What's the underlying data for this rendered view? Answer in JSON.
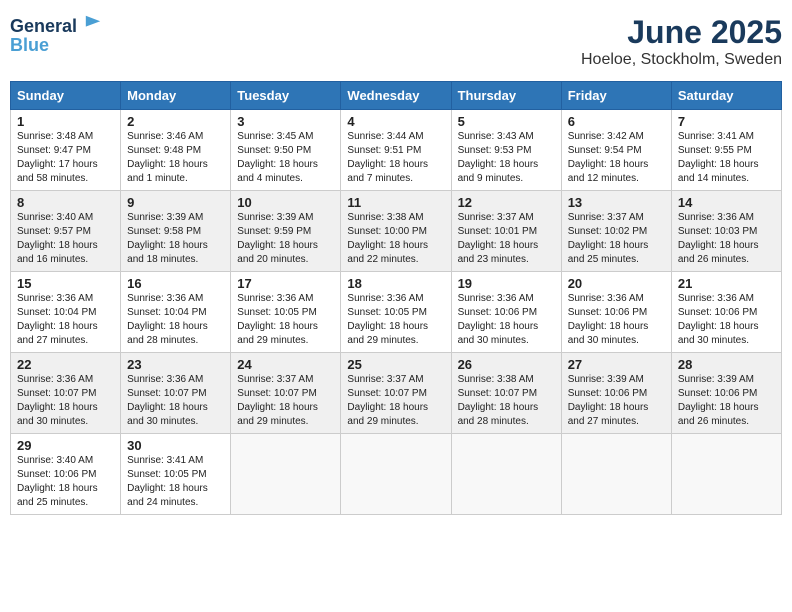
{
  "header": {
    "logo_line1": "General",
    "logo_line2": "Blue",
    "month_year": "June 2025",
    "location": "Hoeloe, Stockholm, Sweden"
  },
  "days_of_week": [
    "Sunday",
    "Monday",
    "Tuesday",
    "Wednesday",
    "Thursday",
    "Friday",
    "Saturday"
  ],
  "weeks": [
    [
      {
        "day": 1,
        "sunrise": "3:48 AM",
        "sunset": "9:47 PM",
        "daylight": "17 hours and 58 minutes."
      },
      {
        "day": 2,
        "sunrise": "3:46 AM",
        "sunset": "9:48 PM",
        "daylight": "18 hours and 1 minute."
      },
      {
        "day": 3,
        "sunrise": "3:45 AM",
        "sunset": "9:50 PM",
        "daylight": "18 hours and 4 minutes."
      },
      {
        "day": 4,
        "sunrise": "3:44 AM",
        "sunset": "9:51 PM",
        "daylight": "18 hours and 7 minutes."
      },
      {
        "day": 5,
        "sunrise": "3:43 AM",
        "sunset": "9:53 PM",
        "daylight": "18 hours and 9 minutes."
      },
      {
        "day": 6,
        "sunrise": "3:42 AM",
        "sunset": "9:54 PM",
        "daylight": "18 hours and 12 minutes."
      },
      {
        "day": 7,
        "sunrise": "3:41 AM",
        "sunset": "9:55 PM",
        "daylight": "18 hours and 14 minutes."
      }
    ],
    [
      {
        "day": 8,
        "sunrise": "3:40 AM",
        "sunset": "9:57 PM",
        "daylight": "18 hours and 16 minutes."
      },
      {
        "day": 9,
        "sunrise": "3:39 AM",
        "sunset": "9:58 PM",
        "daylight": "18 hours and 18 minutes."
      },
      {
        "day": 10,
        "sunrise": "3:39 AM",
        "sunset": "9:59 PM",
        "daylight": "18 hours and 20 minutes."
      },
      {
        "day": 11,
        "sunrise": "3:38 AM",
        "sunset": "10:00 PM",
        "daylight": "18 hours and 22 minutes."
      },
      {
        "day": 12,
        "sunrise": "3:37 AM",
        "sunset": "10:01 PM",
        "daylight": "18 hours and 23 minutes."
      },
      {
        "day": 13,
        "sunrise": "3:37 AM",
        "sunset": "10:02 PM",
        "daylight": "18 hours and 25 minutes."
      },
      {
        "day": 14,
        "sunrise": "3:36 AM",
        "sunset": "10:03 PM",
        "daylight": "18 hours and 26 minutes."
      }
    ],
    [
      {
        "day": 15,
        "sunrise": "3:36 AM",
        "sunset": "10:04 PM",
        "daylight": "18 hours and 27 minutes."
      },
      {
        "day": 16,
        "sunrise": "3:36 AM",
        "sunset": "10:04 PM",
        "daylight": "18 hours and 28 minutes."
      },
      {
        "day": 17,
        "sunrise": "3:36 AM",
        "sunset": "10:05 PM",
        "daylight": "18 hours and 29 minutes."
      },
      {
        "day": 18,
        "sunrise": "3:36 AM",
        "sunset": "10:05 PM",
        "daylight": "18 hours and 29 minutes."
      },
      {
        "day": 19,
        "sunrise": "3:36 AM",
        "sunset": "10:06 PM",
        "daylight": "18 hours and 30 minutes."
      },
      {
        "day": 20,
        "sunrise": "3:36 AM",
        "sunset": "10:06 PM",
        "daylight": "18 hours and 30 minutes."
      },
      {
        "day": 21,
        "sunrise": "3:36 AM",
        "sunset": "10:06 PM",
        "daylight": "18 hours and 30 minutes."
      }
    ],
    [
      {
        "day": 22,
        "sunrise": "3:36 AM",
        "sunset": "10:07 PM",
        "daylight": "18 hours and 30 minutes."
      },
      {
        "day": 23,
        "sunrise": "3:36 AM",
        "sunset": "10:07 PM",
        "daylight": "18 hours and 30 minutes."
      },
      {
        "day": 24,
        "sunrise": "3:37 AM",
        "sunset": "10:07 PM",
        "daylight": "18 hours and 29 minutes."
      },
      {
        "day": 25,
        "sunrise": "3:37 AM",
        "sunset": "10:07 PM",
        "daylight": "18 hours and 29 minutes."
      },
      {
        "day": 26,
        "sunrise": "3:38 AM",
        "sunset": "10:07 PM",
        "daylight": "18 hours and 28 minutes."
      },
      {
        "day": 27,
        "sunrise": "3:39 AM",
        "sunset": "10:06 PM",
        "daylight": "18 hours and 27 minutes."
      },
      {
        "day": 28,
        "sunrise": "3:39 AM",
        "sunset": "10:06 PM",
        "daylight": "18 hours and 26 minutes."
      }
    ],
    [
      {
        "day": 29,
        "sunrise": "3:40 AM",
        "sunset": "10:06 PM",
        "daylight": "18 hours and 25 minutes."
      },
      {
        "day": 30,
        "sunrise": "3:41 AM",
        "sunset": "10:05 PM",
        "daylight": "18 hours and 24 minutes."
      },
      null,
      null,
      null,
      null,
      null
    ]
  ]
}
